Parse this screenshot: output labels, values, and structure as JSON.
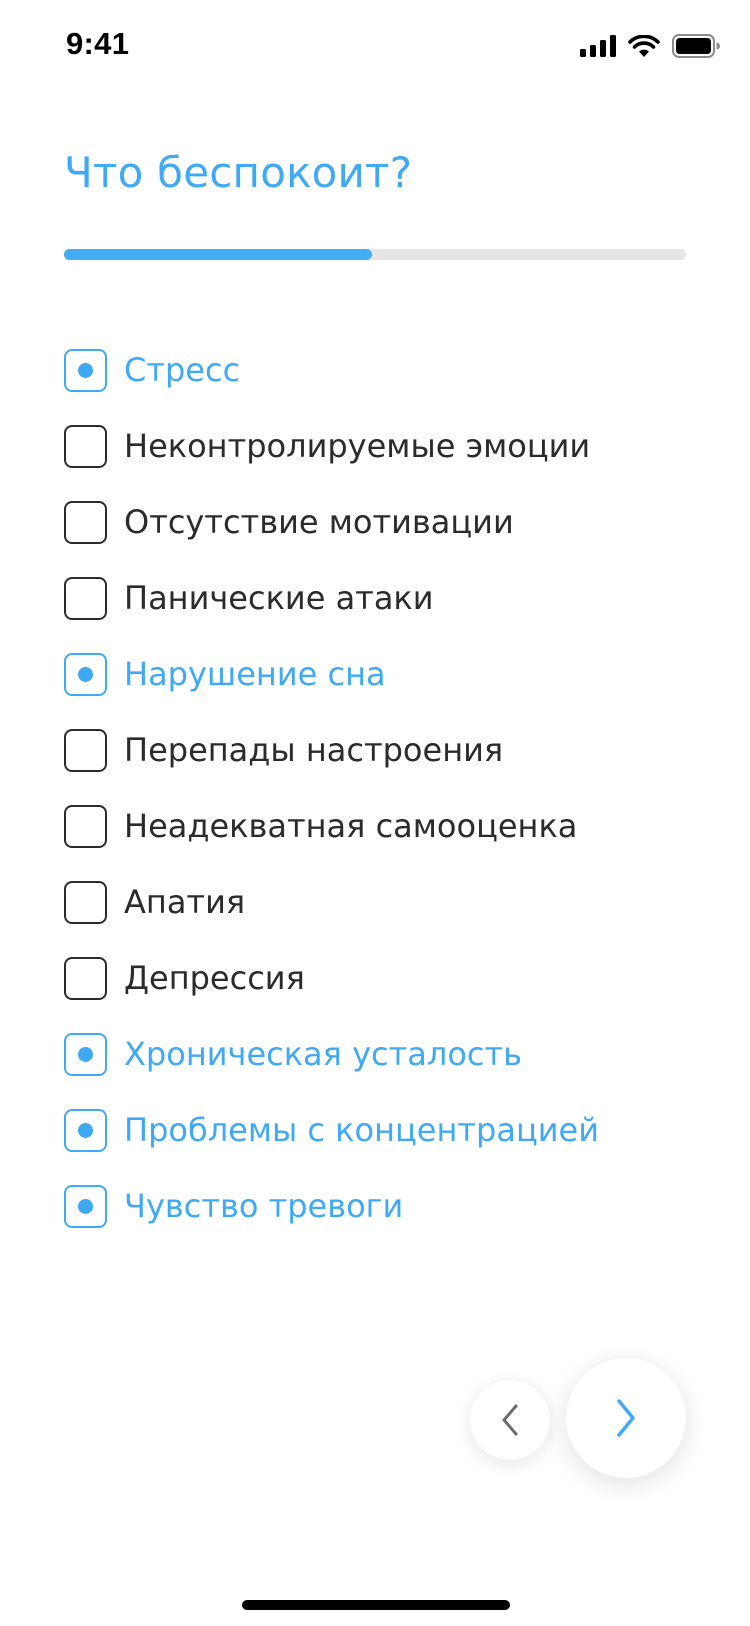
{
  "status_bar": {
    "time": "9:41",
    "icons": [
      "signal-icon",
      "wifi-icon",
      "battery-icon"
    ]
  },
  "header": {
    "title": "Что беспокоит?"
  },
  "progress": {
    "value": 0.495
  },
  "options": [
    {
      "label": "Стресс",
      "checked": true
    },
    {
      "label": "Неконтролируемые эмоции",
      "checked": false
    },
    {
      "label": "Отсутствие мотивации",
      "checked": false
    },
    {
      "label": "Панические атаки",
      "checked": false
    },
    {
      "label": "Нарушение сна",
      "checked": true
    },
    {
      "label": "Перепады настроения",
      "checked": false
    },
    {
      "label": "Неадекватная самооценка",
      "checked": false
    },
    {
      "label": "Апатия",
      "checked": false
    },
    {
      "label": "Депрессия",
      "checked": false
    },
    {
      "label": "Хроническая усталость",
      "checked": true
    },
    {
      "label": "Проблемы с концентрацией",
      "checked": true
    },
    {
      "label": "Чувство тревоги",
      "checked": true
    }
  ],
  "navigation": {
    "back_icon": "chevron-left-icon",
    "next_icon": "chevron-right-icon"
  },
  "colors": {
    "accent": "#3fa9f5",
    "text": "#2b2b2b",
    "track": "#e6e6e6"
  }
}
